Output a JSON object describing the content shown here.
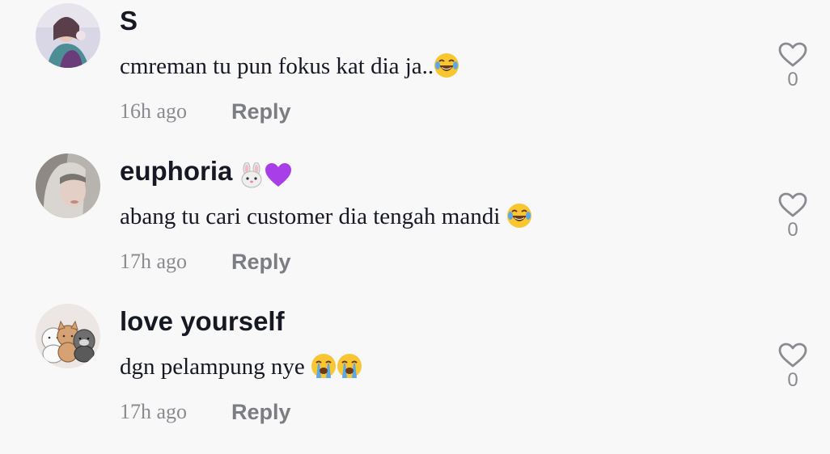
{
  "comments": [
    {
      "username": "S",
      "username_emoji": "",
      "text": "cmreman tu pun fokus kat dia ja..",
      "text_emoji": [
        "joy"
      ],
      "time": "16h ago",
      "reply_label": "Reply",
      "likes": "0"
    },
    {
      "username": "euphoria",
      "username_emoji": "rabbit-face purple-heart",
      "text": "abang tu cari customer dia tengah mandi ",
      "text_emoji": [
        "joy"
      ],
      "time": "17h ago",
      "reply_label": "Reply",
      "likes": "0"
    },
    {
      "username": "love yourself",
      "username_emoji": "",
      "text": "dgn pelampung nye ",
      "text_emoji": [
        "loudly-crying",
        "loudly-crying"
      ],
      "time": "17h ago",
      "reply_label": "Reply",
      "likes": "0"
    }
  ],
  "colors": {
    "background": "#f8f8f8",
    "primary_text": "#161823",
    "secondary_text": "#8a8b91",
    "reply_text": "#7c7d83"
  }
}
